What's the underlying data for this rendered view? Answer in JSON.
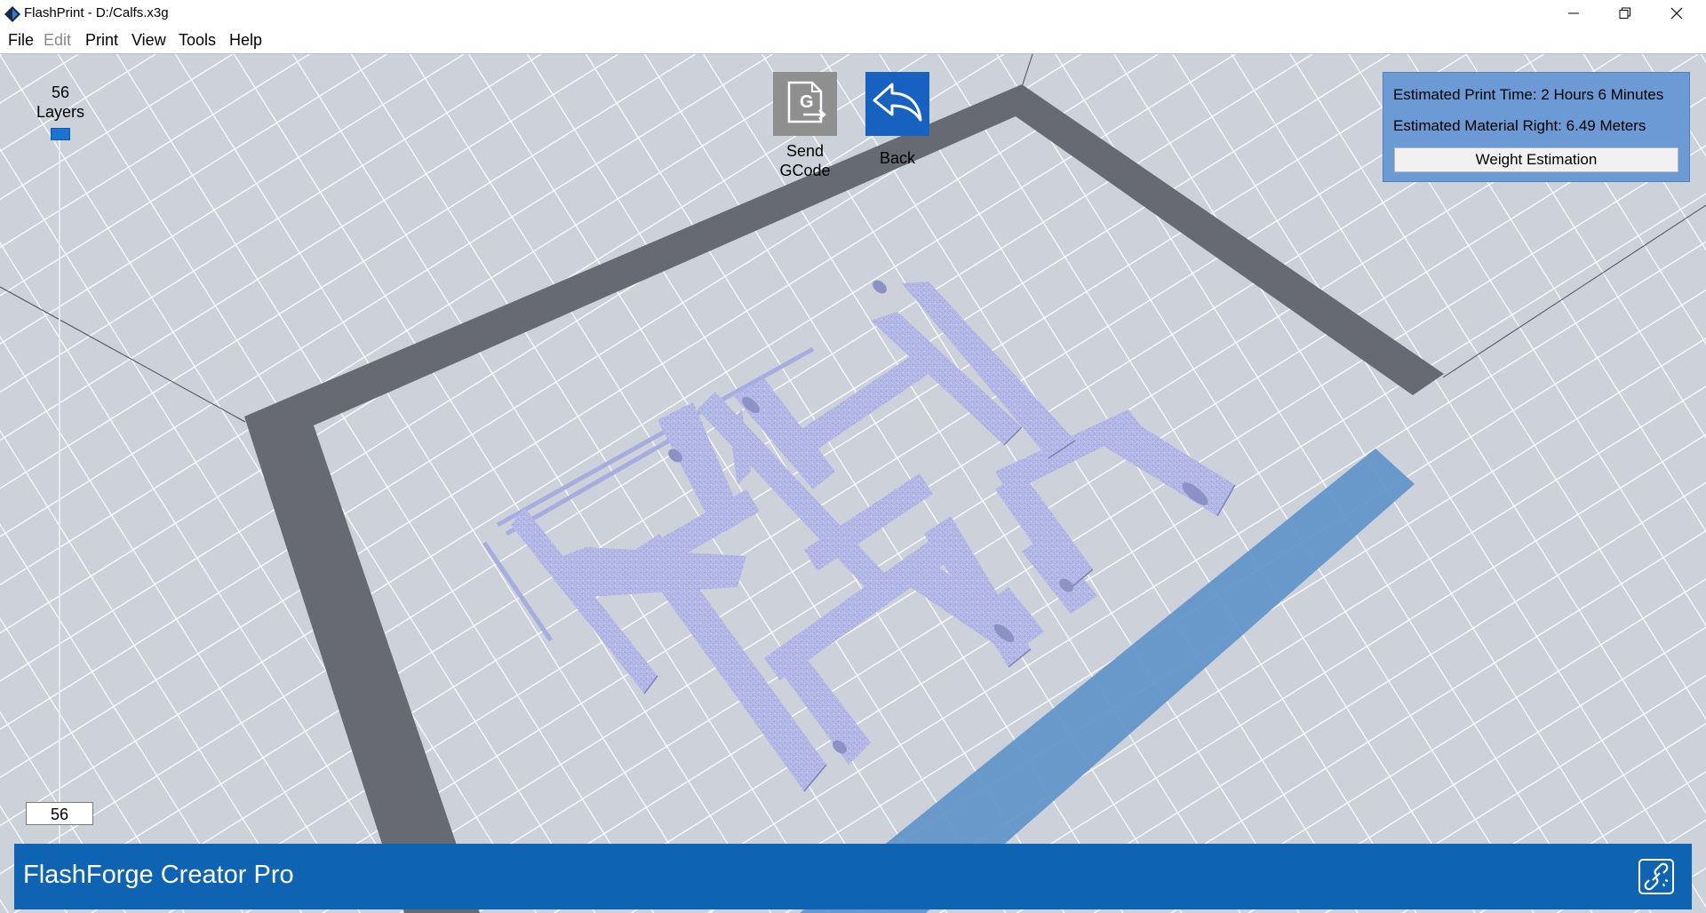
{
  "window": {
    "title": "FlashPrint - D:/Calfs.x3g",
    "controls": [
      "minimize-icon",
      "restore-icon",
      "close-icon"
    ]
  },
  "menu": {
    "items": [
      {
        "label": "File",
        "enabled": true
      },
      {
        "label": "Edit",
        "enabled": false
      },
      {
        "label": "Print",
        "enabled": true
      },
      {
        "label": "View",
        "enabled": true
      },
      {
        "label": "Tools",
        "enabled": true
      },
      {
        "label": "Help",
        "enabled": true
      }
    ]
  },
  "layers": {
    "count": "56",
    "label": "Layers",
    "input_value": "56"
  },
  "toolbar": {
    "send_label": "Send\nGCode",
    "back_label": "Back"
  },
  "estimate": {
    "time_label": "Estimated Print Time:",
    "time_value": "2 Hours 6 Minutes",
    "material_label": "Estimated Material Right:",
    "material_value": "6.49 Meters",
    "weight_button": "Weight Estimation"
  },
  "status": {
    "printer_name": "FlashForge Creator Pro"
  },
  "colors": {
    "accent": "#0f63b3",
    "panel": "#6c9ad4",
    "model": "#b9bde8",
    "plate": "#cfd4dc",
    "frame": "#6b6e73"
  }
}
